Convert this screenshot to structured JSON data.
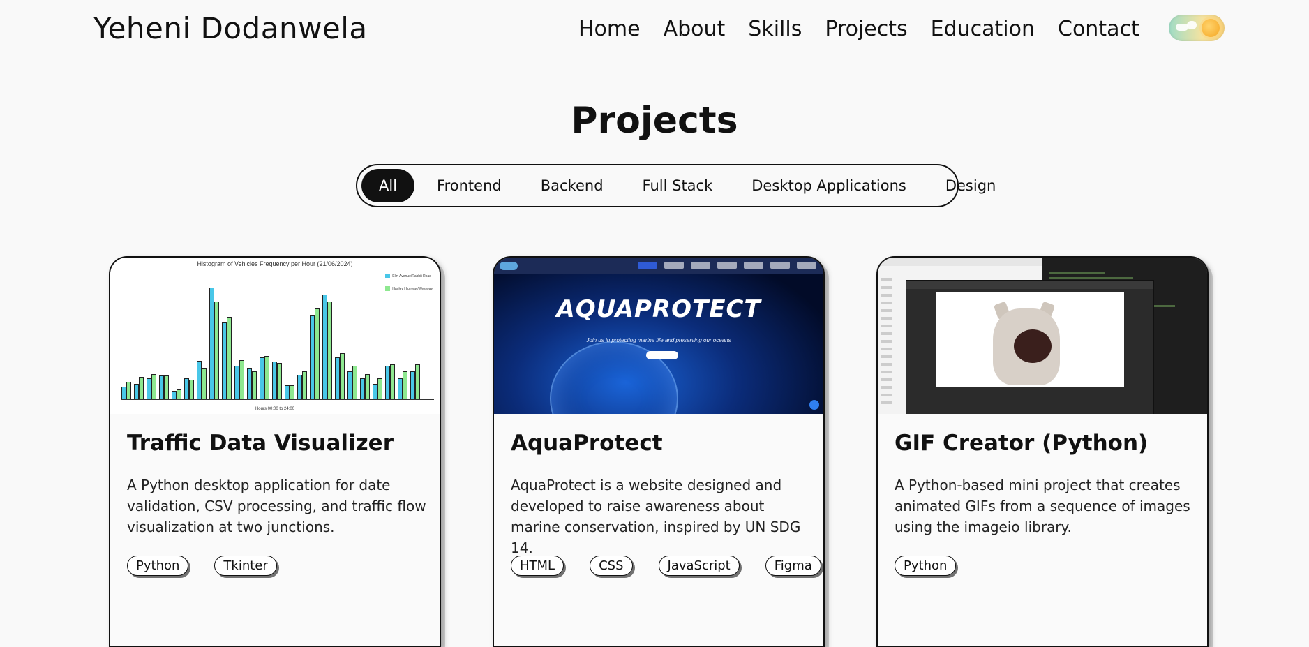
{
  "header": {
    "brand": "Yeheni Dodanwela",
    "nav": [
      "Home",
      "About",
      "Skills",
      "Projects",
      "Education",
      "Contact"
    ]
  },
  "section": {
    "title": "Projects"
  },
  "filters": [
    {
      "label": "All",
      "active": true
    },
    {
      "label": "Frontend",
      "active": false
    },
    {
      "label": "Backend",
      "active": false
    },
    {
      "label": "Full Stack",
      "active": false
    },
    {
      "label": "Desktop Applications",
      "active": false
    },
    {
      "label": "Design",
      "active": false
    }
  ],
  "cards": [
    {
      "title": "Traffic Data Visualizer",
      "description": "A Python desktop application for date validation, CSV processing, and traffic flow visualization at two junctions.",
      "tags": [
        "Python",
        "Tkinter"
      ],
      "thumb": {
        "chart_title": "Histogram of Vehicles Frequency per Hour (21/06/2024)",
        "legend": [
          "Elm Avenue/Rabbit Road",
          "Hanley Highway/Westway"
        ],
        "xlabel": "Hours 00:00 to 24:00"
      }
    },
    {
      "title": "AquaProtect",
      "description": "AquaProtect is a website designed and developed to raise awareness about marine conservation, inspired by UN SDG 14.",
      "tags": [
        "HTML",
        "CSS",
        "JavaScript",
        "Figma"
      ],
      "thumb": {
        "hero": "AQUAPROTECT",
        "sub": "Join us in protecting marine life and preserving our oceans"
      }
    },
    {
      "title": "GIF Creator (Python)",
      "description": "A Python-based mini project that creates animated GIFs from a sequence of images using the imageio library.",
      "tags": [
        "Python"
      ]
    }
  ],
  "colors": {
    "accent": "#111111",
    "background": "#f9f9f9",
    "bar_a": "#49c7e8",
    "bar_b": "#8ee890"
  }
}
